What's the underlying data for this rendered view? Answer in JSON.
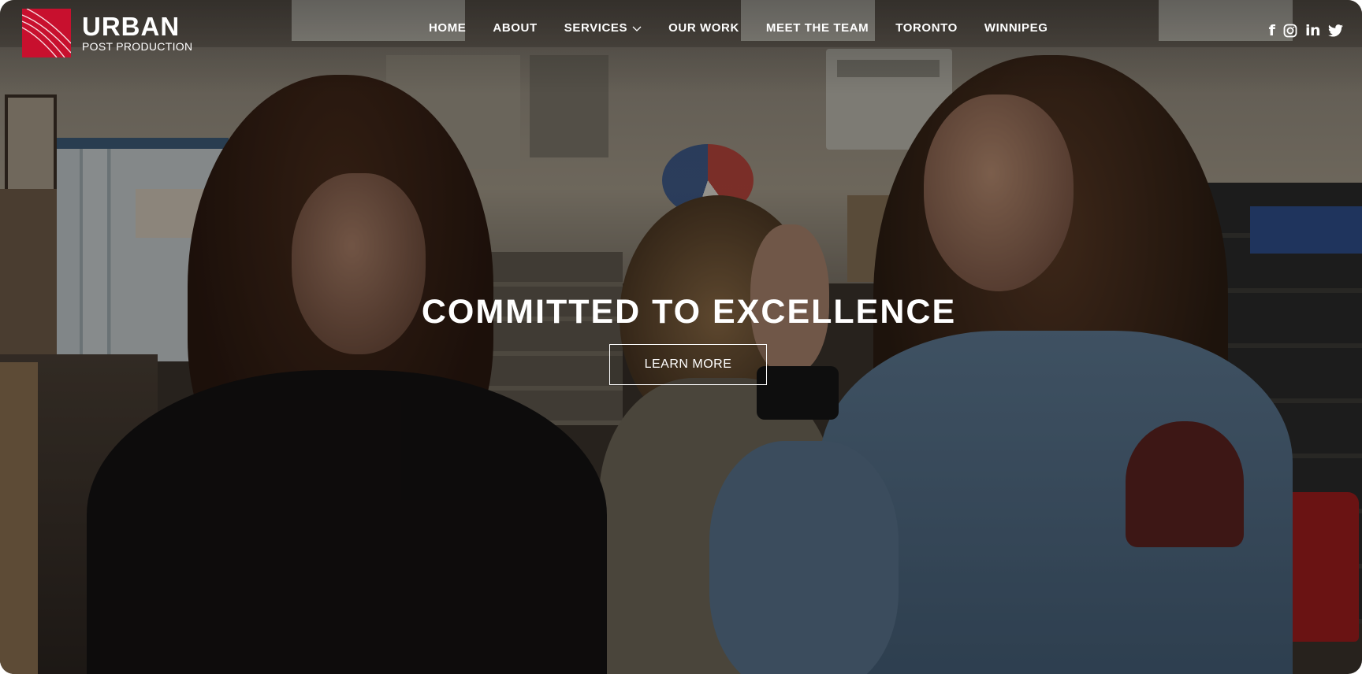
{
  "brand": {
    "title": "URBAN",
    "subtitle": "POST PRODUCTION",
    "accent_color": "#c8102e"
  },
  "nav": {
    "items": [
      {
        "label": "HOME"
      },
      {
        "label": "ABOUT"
      },
      {
        "label": "SERVICES",
        "has_dropdown": true
      },
      {
        "label": "OUR WORK"
      },
      {
        "label": "MEET THE TEAM"
      },
      {
        "label": "TORONTO"
      },
      {
        "label": "WINNIPEG"
      }
    ]
  },
  "social": [
    {
      "icon": "facebook-icon",
      "glyph": "f"
    },
    {
      "icon": "instagram-icon"
    },
    {
      "icon": "linkedin-icon",
      "glyph": "in"
    },
    {
      "icon": "twitter-icon"
    }
  ],
  "hero": {
    "headline": "COMMITTED TO EXCELLENCE",
    "cta_label": "LEARN MORE"
  }
}
